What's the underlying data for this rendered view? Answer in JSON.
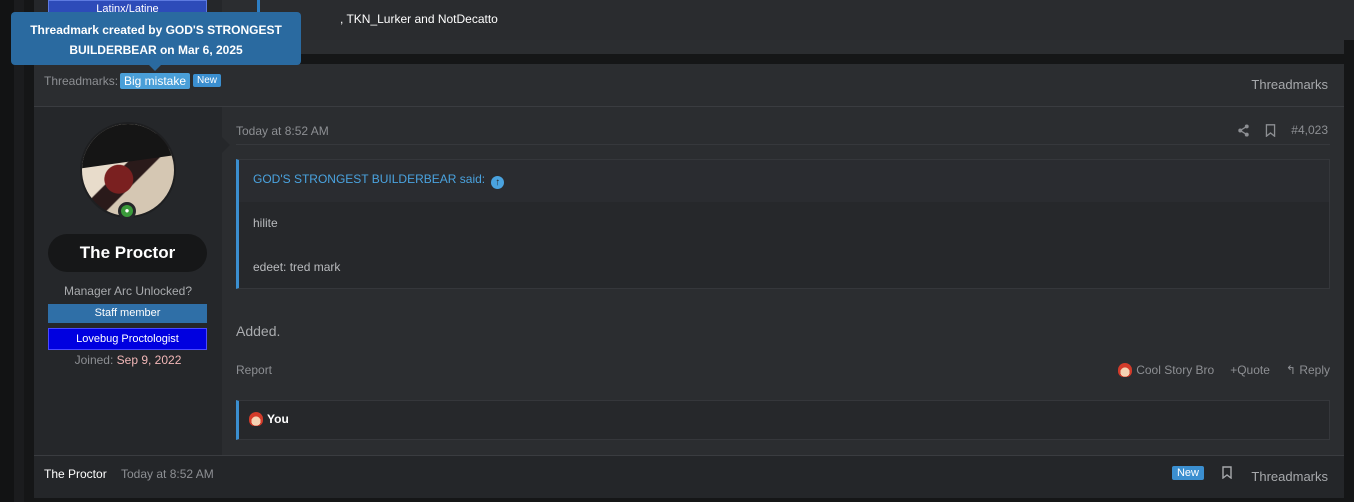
{
  "prev_post": {
    "badge": "Latinx/Latine",
    "reactions_text": ", TKN_Lurker and NotDecatto"
  },
  "tooltip": {
    "line1": "Threadmark created by GOD'S STRONGEST",
    "line2": "BUILDERBEAR on Mar 6, 2025"
  },
  "threadmarks_bar": {
    "label": "Threadmarks:",
    "chip": "Big mistake",
    "new_badge": "New",
    "right_link": "Threadmarks"
  },
  "user": {
    "name": "The Proctor",
    "title": "Manager Arc Unlocked?",
    "banner_staff": "Staff member",
    "banner_custom": "Lovebug Proctologist",
    "joined_label": "Joined:",
    "joined_date": "Sep 9, 2022"
  },
  "post": {
    "date": "Today at 8:52 AM",
    "number": "#4,023",
    "quote": {
      "author": "GOD'S STRONGEST BUILDERBEAR said:",
      "line1": "hilite",
      "line2": "edeet: tred mark"
    },
    "body": "Added.",
    "actions": {
      "report": "Report",
      "reaction": "Cool Story Bro",
      "quote": "+Quote",
      "reply": "Reply"
    },
    "reacted_by": "You"
  },
  "footer": {
    "user": "The Proctor",
    "date": "Today at 8:52 AM",
    "new_badge": "New",
    "threadmarks": "Threadmarks"
  },
  "colors": {
    "accent": "#3b8fd0",
    "staff": "#2f6fa7",
    "custom_banner": "#0000e0",
    "joined_date": "#f2b7b7"
  }
}
